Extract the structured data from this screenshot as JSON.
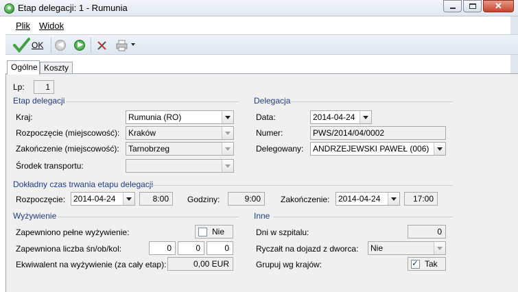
{
  "window": {
    "title": "Etap delegacji: 1 - Rumunia"
  },
  "menu": [
    {
      "label": "Plik"
    },
    {
      "label": "Widok"
    }
  ],
  "toolbar": {
    "ok_label": "OK"
  },
  "tabs": [
    {
      "label": "Ogólne"
    },
    {
      "label": "Koszty"
    }
  ],
  "lp": {
    "label": "Lp:",
    "value": "1"
  },
  "etap": {
    "title": "Etap delegacji",
    "kraj_label": "Kraj:",
    "kraj_value": "Rumunia (RO)",
    "rozpoczecie_label": "Rozpoczęcie (miejscowość):",
    "rozpoczecie_value": "Kraków",
    "zakonczenie_label": "Zakończenie (miejscowość):",
    "zakonczenie_value": "Tarnobrzeg",
    "transport_label": "Środek transportu:",
    "transport_value": ""
  },
  "delegacja": {
    "title": "Delegacja",
    "data_label": "Data:",
    "data_value": "2014-04-24",
    "numer_label": "Numer:",
    "numer_value": "PWS/2014/04/0002",
    "delegowany_label": "Delegowany:",
    "delegowany_value": "ANDRZEJEWSKI PAWEŁ (006)"
  },
  "czas": {
    "title": "Dokładny czas trwania etapu delegacji",
    "start_label": "Rozpoczęcie:",
    "start_date": "2014-04-24",
    "start_time": "8:00",
    "hours_label": "Godziny:",
    "hours_value": "9:00",
    "end_label": "Zakończenie:",
    "end_date": "2014-04-24",
    "end_time": "17:00"
  },
  "wyzywienie": {
    "title": "Wyżywienie",
    "pelne_label": "Zapewniono pełne wyżywienie:",
    "pelne_value": "Nie",
    "liczba_label": "Zapewniona liczba śn/ob/kol:",
    "sn": "0",
    "ob": "0",
    "kol": "0",
    "ekwiwalent_label": "Ekwiwalent na wyżywienie (za cały etap):",
    "ekwiwalent_value": "0,00 EUR"
  },
  "inne": {
    "title": "Inne",
    "dni_label": "Dni w szpitalu:",
    "dni_value": "0",
    "ryczalt_label": "Ryczałt na dojazd z dworca:",
    "ryczalt_value": "Nie",
    "grupuj_label": "Grupuj wg krajów:",
    "grupuj_value": "Tak"
  }
}
